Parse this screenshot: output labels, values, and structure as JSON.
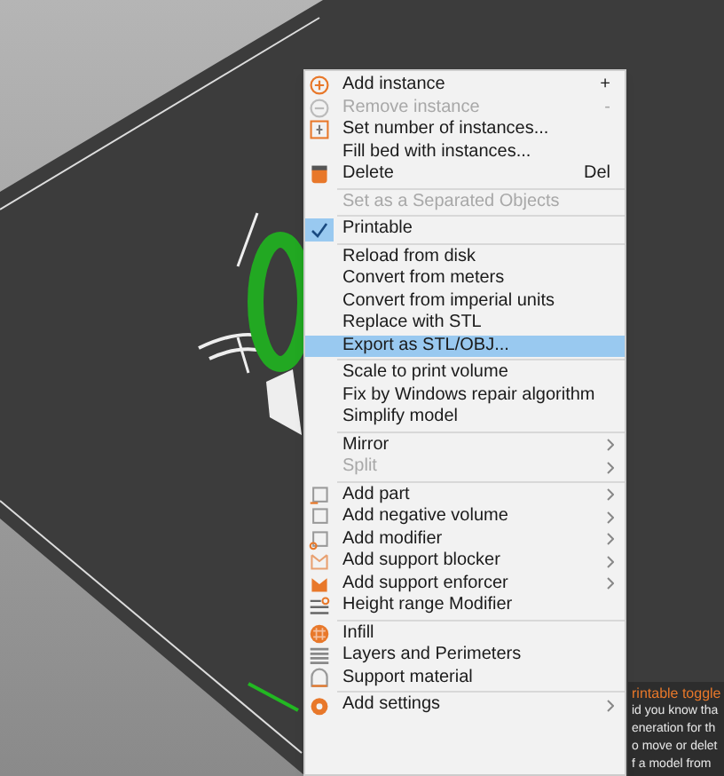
{
  "context_menu": {
    "items": [
      {
        "kind": "item",
        "label": "Add instance",
        "shortcut": "+",
        "disabled": false,
        "submenu": false,
        "checked": false,
        "selected": false
      },
      {
        "kind": "item",
        "label": "Remove instance",
        "shortcut": "-",
        "disabled": true,
        "submenu": false,
        "checked": false,
        "selected": false
      },
      {
        "kind": "item",
        "label": "Set number of instances...",
        "disabled": false,
        "submenu": false,
        "checked": false,
        "selected": false
      },
      {
        "kind": "item",
        "label": "Fill bed with instances...",
        "disabled": false,
        "submenu": false,
        "checked": false,
        "selected": false
      },
      {
        "kind": "item",
        "label": "Delete",
        "shortcut": "Del",
        "disabled": false,
        "submenu": false,
        "checked": false,
        "selected": false
      },
      {
        "kind": "separator"
      },
      {
        "kind": "item",
        "label": "Set as a Separated Objects",
        "disabled": true,
        "submenu": false,
        "checked": false,
        "selected": false
      },
      {
        "kind": "separator"
      },
      {
        "kind": "item",
        "label": "Printable",
        "disabled": false,
        "submenu": false,
        "checked": true,
        "selected": false
      },
      {
        "kind": "separator"
      },
      {
        "kind": "item",
        "label": "Reload from disk",
        "disabled": false,
        "submenu": false,
        "checked": false,
        "selected": false
      },
      {
        "kind": "item",
        "label": "Convert from meters",
        "disabled": false,
        "submenu": false,
        "checked": false,
        "selected": false
      },
      {
        "kind": "item",
        "label": "Convert from imperial units",
        "disabled": false,
        "submenu": false,
        "checked": false,
        "selected": false
      },
      {
        "kind": "item",
        "label": "Replace with STL",
        "disabled": false,
        "submenu": false,
        "checked": false,
        "selected": false
      },
      {
        "kind": "item",
        "label": "Export as STL/OBJ...",
        "disabled": false,
        "submenu": false,
        "checked": false,
        "selected": true
      },
      {
        "kind": "separator"
      },
      {
        "kind": "item",
        "label": "Scale to print volume",
        "disabled": false,
        "submenu": false,
        "checked": false,
        "selected": false
      },
      {
        "kind": "item",
        "label": "Fix by Windows repair algorithm",
        "disabled": false,
        "submenu": false,
        "checked": false,
        "selected": false
      },
      {
        "kind": "item",
        "label": "Simplify model",
        "disabled": false,
        "submenu": false,
        "checked": false,
        "selected": false
      },
      {
        "kind": "separator"
      },
      {
        "kind": "item",
        "label": "Mirror",
        "disabled": false,
        "submenu": true,
        "checked": false,
        "selected": false
      },
      {
        "kind": "item",
        "label": "Split",
        "disabled": true,
        "submenu": true,
        "checked": false,
        "selected": false
      },
      {
        "kind": "separator"
      },
      {
        "kind": "item",
        "label": "Add part",
        "disabled": false,
        "submenu": true,
        "checked": false,
        "selected": false
      },
      {
        "kind": "item",
        "label": "Add negative volume",
        "disabled": false,
        "submenu": true,
        "checked": false,
        "selected": false
      },
      {
        "kind": "item",
        "label": "Add modifier",
        "disabled": false,
        "submenu": true,
        "checked": false,
        "selected": false
      },
      {
        "kind": "item",
        "label": "Add support blocker",
        "disabled": false,
        "submenu": true,
        "checked": false,
        "selected": false
      },
      {
        "kind": "item",
        "label": "Add support enforcer",
        "disabled": false,
        "submenu": true,
        "checked": false,
        "selected": false
      },
      {
        "kind": "item",
        "label": "Height range Modifier",
        "disabled": false,
        "submenu": false,
        "checked": false,
        "selected": false
      },
      {
        "kind": "separator"
      },
      {
        "kind": "item",
        "label": "Infill",
        "disabled": false,
        "submenu": false,
        "checked": false,
        "selected": false
      },
      {
        "kind": "item",
        "label": "Layers and Perimeters",
        "disabled": false,
        "submenu": false,
        "checked": false,
        "selected": false
      },
      {
        "kind": "item",
        "label": "Support material",
        "disabled": false,
        "submenu": false,
        "checked": false,
        "selected": false
      },
      {
        "kind": "separator"
      },
      {
        "kind": "item",
        "label": "Add settings",
        "disabled": false,
        "submenu": true,
        "checked": false,
        "selected": false
      }
    ]
  },
  "hint": {
    "title": "rintable toggle",
    "lines": [
      "id you know tha",
      "eneration for th",
      "o move or delet",
      "f a model from"
    ]
  }
}
